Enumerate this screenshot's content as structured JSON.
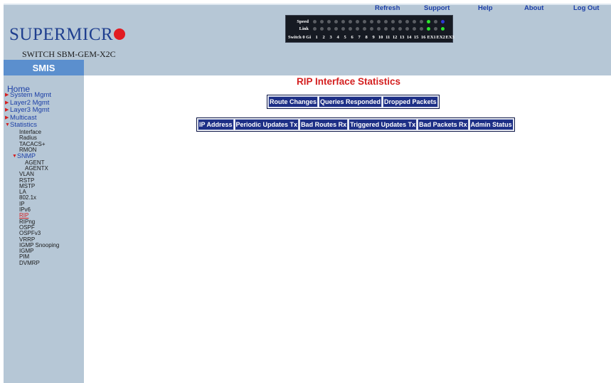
{
  "brand": {
    "logo_text": "SUPERMICR",
    "switch_name": "SWITCH SBM-GEM-X2C"
  },
  "port_panel": {
    "speed_label": "Speed",
    "link_label": "Link",
    "switch_label": "Switch 0 Gi",
    "port_numbers": [
      "1",
      "2",
      "3",
      "4",
      "5",
      "6",
      "7",
      "8",
      "9",
      "10",
      "11",
      "12",
      "13",
      "14",
      "15",
      "16"
    ],
    "ext_ports": [
      "EX1",
      "EX2",
      "EX3"
    ],
    "speed_leds": [
      "gray",
      "gray",
      "gray",
      "gray",
      "gray",
      "gray",
      "gray",
      "gray",
      "gray",
      "gray",
      "gray",
      "gray",
      "gray",
      "gray",
      "gray",
      "gray",
      "green",
      "gray",
      "blue"
    ],
    "link_leds": [
      "gray",
      "gray",
      "gray",
      "gray",
      "gray",
      "gray",
      "gray",
      "gray",
      "gray",
      "gray",
      "gray",
      "gray",
      "gray",
      "gray",
      "gray",
      "gray",
      "green",
      "gray",
      "green"
    ]
  },
  "nav": {
    "refresh": "Refresh",
    "support": "Support",
    "help": "Help",
    "about": "About",
    "logout": "Log Out"
  },
  "sidebar": {
    "tab": "SMIS",
    "home": "Home",
    "system_mgmt": "System Mgmt",
    "layer2_mgmt": "Layer2 Mgmt",
    "layer3_mgmt": "Layer3 Mgmt",
    "multicast": "Multicast",
    "statistics": "Statistics",
    "stats_items_a": [
      "Interface",
      "Radius",
      "TACACS+",
      "RMON"
    ],
    "snmp": "SNMP",
    "snmp_items": [
      "AGENT",
      "AGENTX"
    ],
    "stats_items_b": [
      "VLAN",
      "RSTP",
      "MSTP",
      "LA",
      "802.1x",
      "IP",
      "IPv6",
      "RIP",
      "RIPng",
      "OSPF",
      "OSPFv3",
      "VRRP",
      "IGMP Snooping",
      "IGMP",
      "PIM",
      "DVMRP"
    ],
    "active_item": "RIP"
  },
  "main": {
    "title": "RIP Interface Statistics",
    "summary_columns": [
      "Route Changes",
      "Queries Responded",
      "Dropped Packets"
    ],
    "interface_columns": [
      "IP Address",
      "Periodic Updates Tx",
      "Bad Routes Rx",
      "Triggered Updates Tx",
      "Bad Packets Rx",
      "Admin Status"
    ]
  }
}
